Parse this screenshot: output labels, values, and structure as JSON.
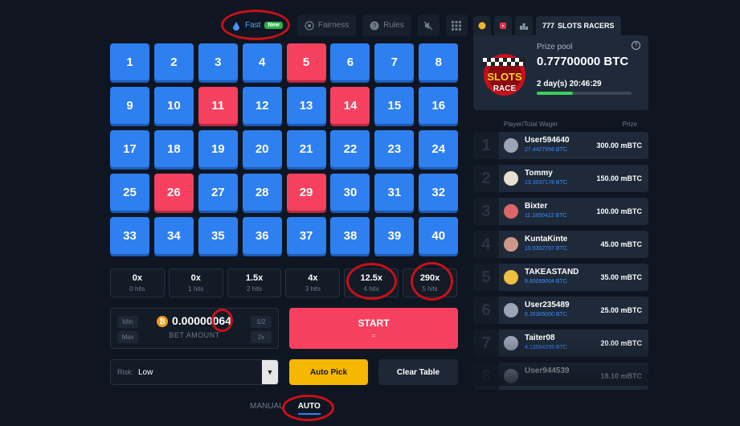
{
  "toolbar": {
    "fast_label": "Fast",
    "new_badge": "New",
    "fairness_label": "Fairness",
    "rules_label": "Rules"
  },
  "grid": {
    "numbers": [
      "1",
      "2",
      "3",
      "4",
      "5",
      "6",
      "7",
      "8",
      "9",
      "10",
      "11",
      "12",
      "13",
      "14",
      "15",
      "16",
      "17",
      "18",
      "19",
      "20",
      "21",
      "22",
      "23",
      "24",
      "25",
      "26",
      "27",
      "28",
      "29",
      "30",
      "31",
      "32",
      "33",
      "34",
      "35",
      "36",
      "37",
      "38",
      "39",
      "40"
    ],
    "selected": [
      "5",
      "11",
      "14",
      "26",
      "29"
    ]
  },
  "multipliers": [
    {
      "value": "0x",
      "hits": "0 hits"
    },
    {
      "value": "0x",
      "hits": "1 hits"
    },
    {
      "value": "1.5x",
      "hits": "2 hits"
    },
    {
      "value": "4x",
      "hits": "3 hits"
    },
    {
      "value": "12.5x",
      "hits": "4 hits"
    },
    {
      "value": "290x",
      "hits": "5 hits"
    }
  ],
  "bet": {
    "min_label": "Min",
    "max_label": "Max",
    "half_label": "1/2",
    "double_label": "2x",
    "amount": "0.00000064",
    "label": "BET AMOUNT",
    "coin_symbol": "₿"
  },
  "start": {
    "label": "START",
    "sub": "="
  },
  "risk": {
    "label": "Risk:",
    "value": "Low"
  },
  "buttons": {
    "auto_pick": "Auto Pick",
    "clear_table": "Clear Table"
  },
  "mode_tabs": {
    "manual": "MANUAL",
    "auto": "AUTO",
    "active": "AUTO"
  },
  "race": {
    "tab_title": "SLOTS RACERS",
    "prize_label": "Prize pool",
    "prize_value": "0.77700000 BTC",
    "time_left": "2 day(s) 20:46:29",
    "progress": 0.38,
    "logo_text_1": "SLOTS",
    "logo_text_2": "RACE",
    "help_symbol": "?"
  },
  "leaderboard": {
    "col_player": "Player/Total Wager",
    "col_prize": "Prize",
    "rows": [
      {
        "rank": "1",
        "name": "User594640",
        "wager": "27.4427956 BTC",
        "prize": "300.00 mBTC"
      },
      {
        "rank": "2",
        "name": "Tommy",
        "wager": "13.3037178 BTC",
        "prize": "150.00 mBTC"
      },
      {
        "rank": "3",
        "name": "Bixter",
        "wager": "11.1850422 BTC",
        "prize": "100.00 mBTC"
      },
      {
        "rank": "4",
        "name": "KuntaKinte",
        "wager": "10.9302707 BTC",
        "prize": "45.00 mBTC"
      },
      {
        "rank": "5",
        "name": "TAKEASTAND",
        "wager": "9.60099004 BTC",
        "prize": "35.00 mBTC"
      },
      {
        "rank": "6",
        "name": "User235489",
        "wager": "6.26365000 BTC",
        "prize": "25.00 mBTC"
      },
      {
        "rank": "7",
        "name": "Taiter08",
        "wager": "4.13564295 BTC",
        "prize": "20.00 mBTC"
      },
      {
        "rank": "8",
        "name": "User944539",
        "wager": "",
        "prize": "18.10 mBTC"
      }
    ]
  }
}
